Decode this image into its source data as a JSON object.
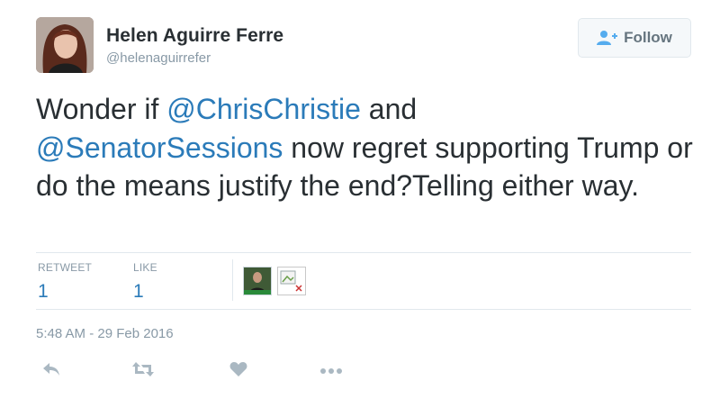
{
  "user": {
    "name": "Helen Aguirre Ferre",
    "handle": "@helenaguirrefer"
  },
  "follow_button": {
    "label": "Follow",
    "icon": "follow-person-plus-icon"
  },
  "tweet": {
    "text_1": "Wonder if ",
    "mention_1": "@ChrisChristie",
    "text_2": " and",
    "mention_2": "@SenatorSessions",
    "text_3": " now regret supporting Trump or do the means justify the end?Telling either way."
  },
  "stats": {
    "retweet_label": "RETWEET",
    "retweet_count": "1",
    "like_label": "LIKE",
    "like_count": "1"
  },
  "timestamp": "5:48 AM - 29 Feb 2016",
  "actions": {
    "reply_icon": "reply-icon",
    "retweet_icon": "retweet-icon",
    "like_icon": "heart-icon",
    "more_icon": "more-dots-icon"
  },
  "colors": {
    "link": "#2b7bb9",
    "text": "#292f33",
    "muted": "#8899a6",
    "action_icon": "#aab8c2",
    "divider": "#e1e8ed"
  }
}
